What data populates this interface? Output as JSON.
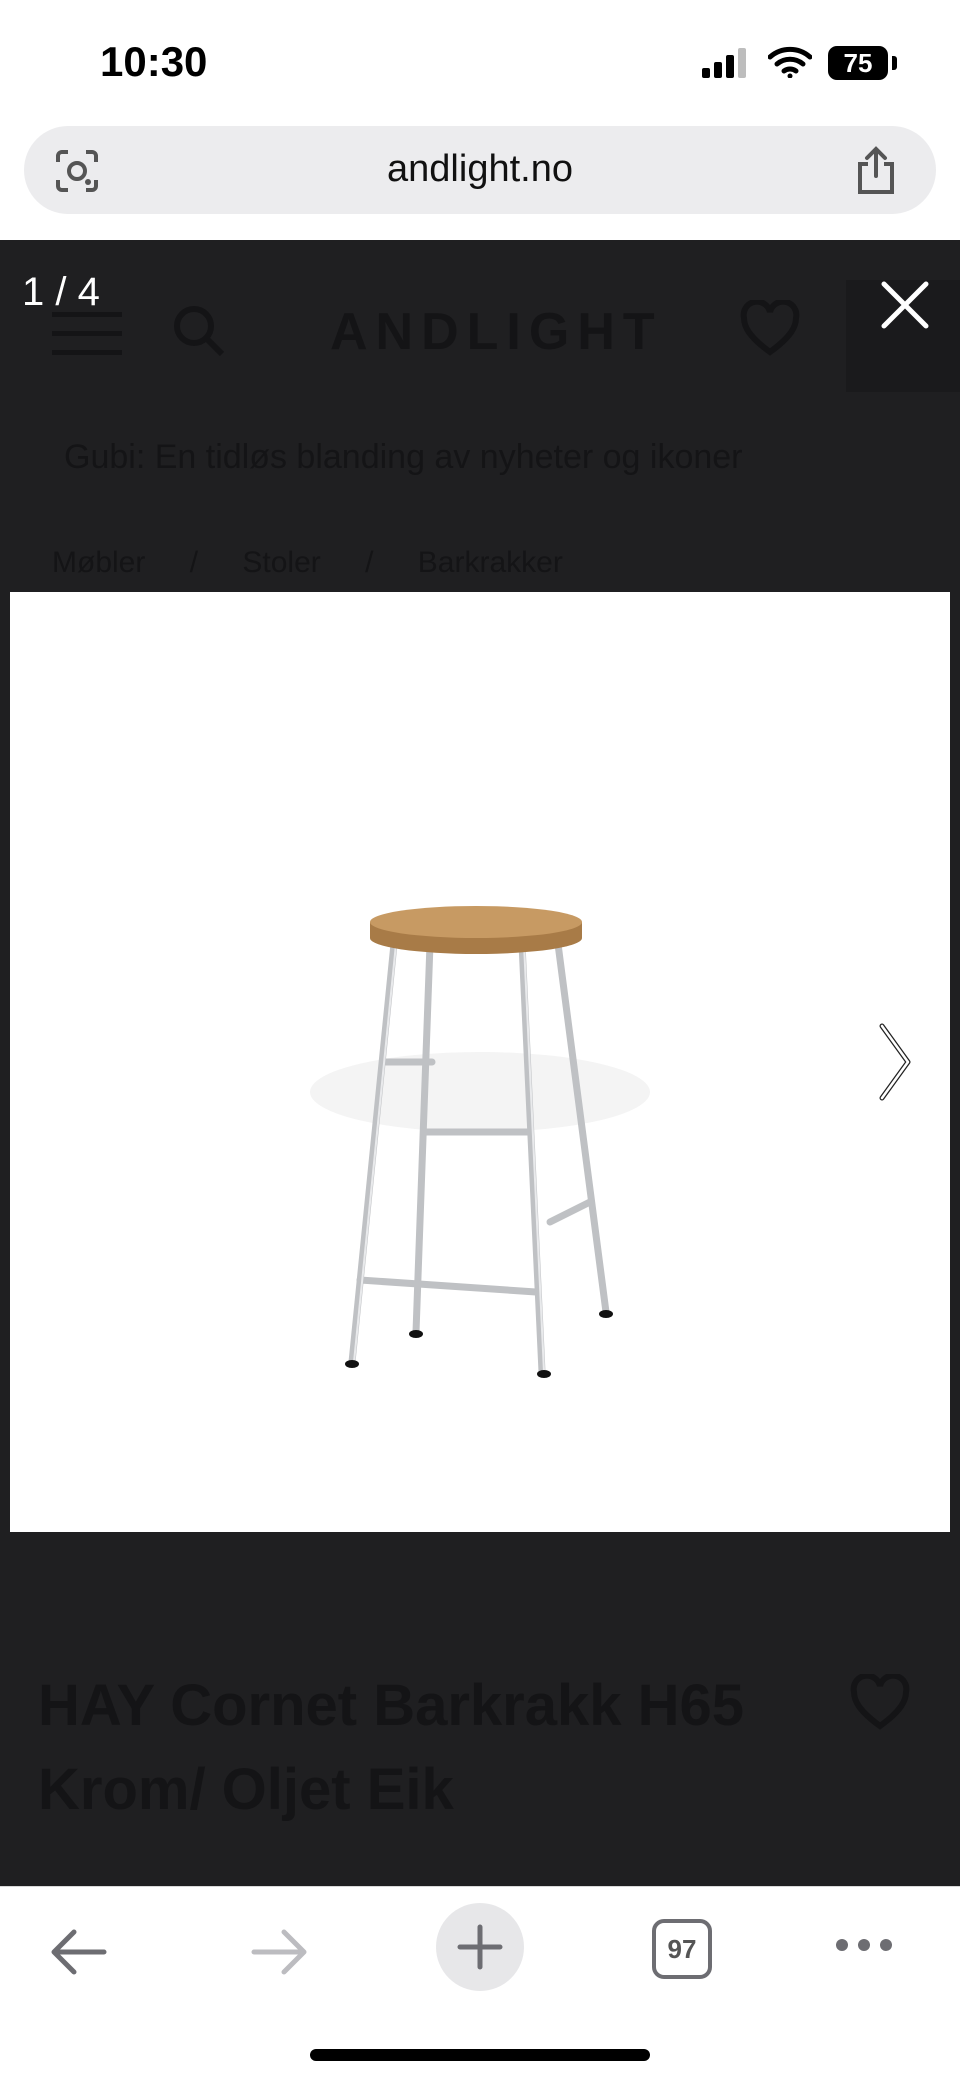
{
  "status": {
    "time": "10:30",
    "battery": "75"
  },
  "browser": {
    "url": "andlight.no",
    "tab_count": "97"
  },
  "gallery": {
    "counter": "1 / 4",
    "background_page": {
      "logo": "ANDLIGHT",
      "banner": "Gubi: En tidløs blanding av nyheter og ikoner",
      "breadcrumb": [
        "Møbler",
        "/",
        "Stoler",
        "/",
        "Barkrakker"
      ],
      "product_title_line1": "HAY Cornet Barkrakk H65",
      "product_title_line2": "Krom/ Oljet Eik"
    }
  },
  "icons": {
    "lens": "google-lens-icon",
    "share": "share-icon",
    "close": "close-icon",
    "prev": "chevron-left-icon",
    "next": "chevron-right-icon",
    "back": "back-arrow-icon",
    "forward": "forward-arrow-icon",
    "new_tab": "plus-icon",
    "more": "more-dots-icon"
  },
  "colors": {
    "overlay": "#1f1f21",
    "seat_wood": "#c79a63",
    "chrome": "#c8cacd"
  }
}
